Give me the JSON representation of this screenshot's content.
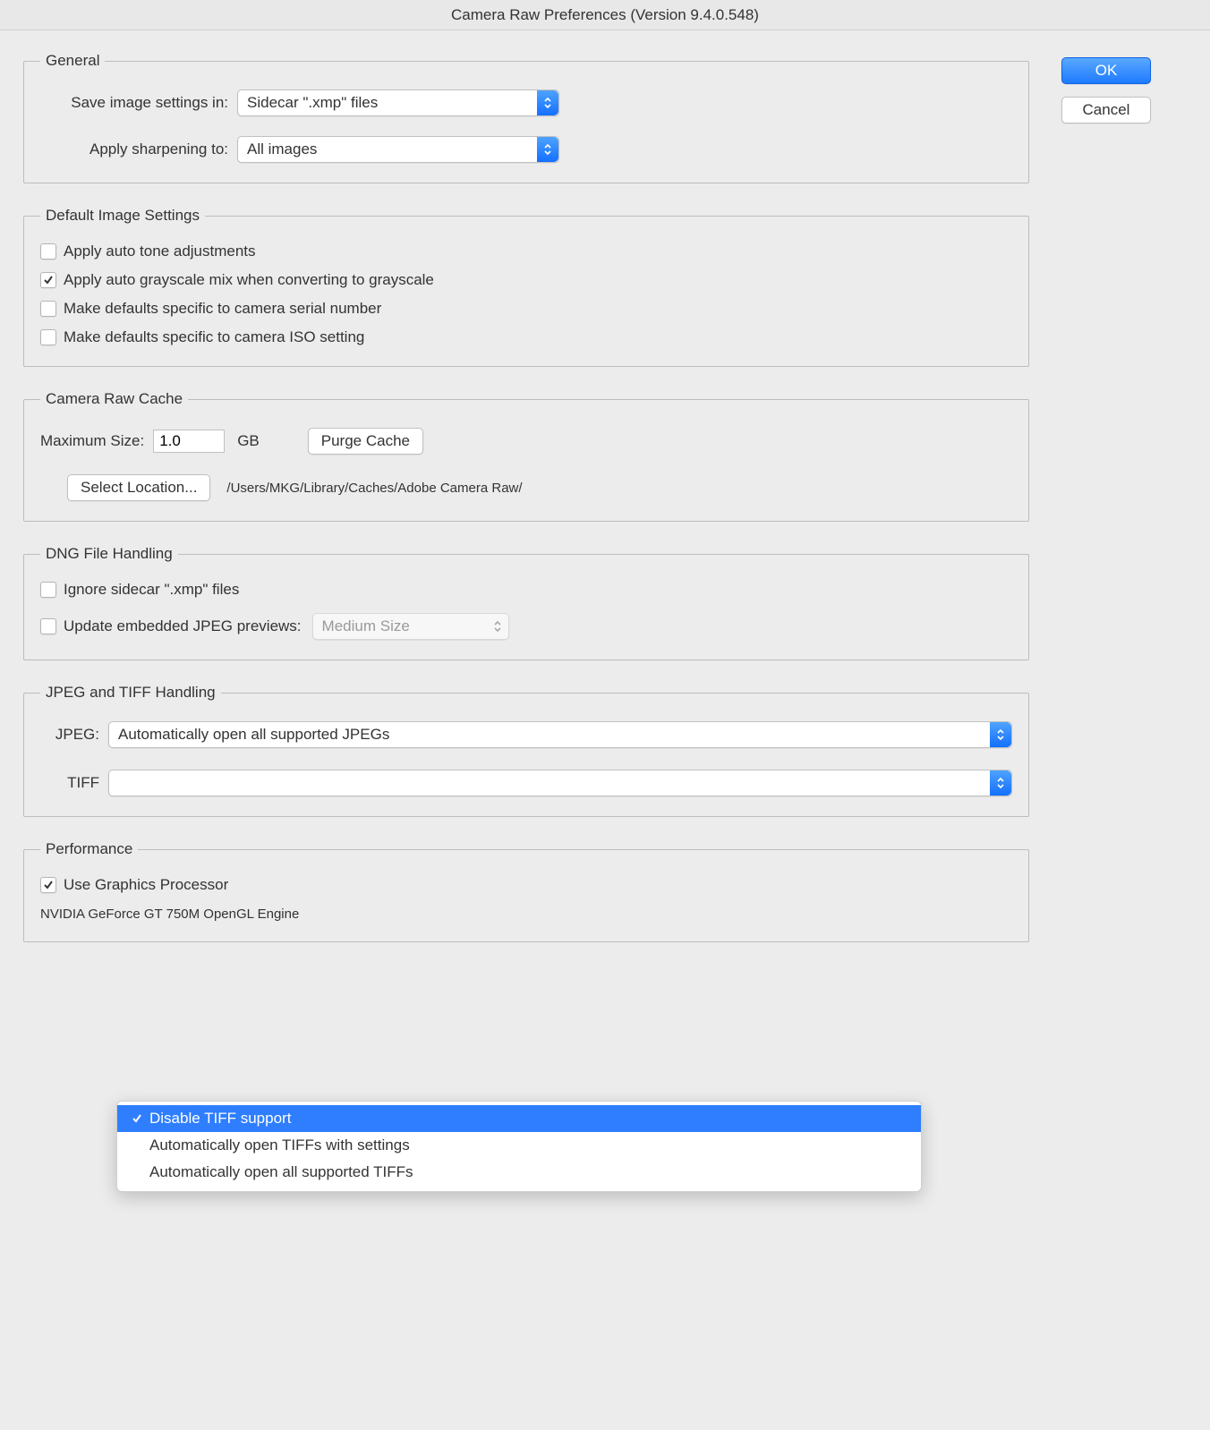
{
  "window_title": "Camera Raw Preferences  (Version 9.4.0.548)",
  "buttons": {
    "ok": "OK",
    "cancel": "Cancel"
  },
  "general": {
    "legend": "General",
    "save_label": "Save image settings in:",
    "save_value": "Sidecar \".xmp\" files",
    "sharpen_label": "Apply sharpening to:",
    "sharpen_value": "All images"
  },
  "default_image": {
    "legend": "Default Image Settings",
    "items": [
      {
        "label": "Apply auto tone adjustments",
        "checked": false
      },
      {
        "label": "Apply auto grayscale mix when converting to grayscale",
        "checked": true
      },
      {
        "label": "Make defaults specific to camera serial number",
        "checked": false
      },
      {
        "label": "Make defaults specific to camera ISO setting",
        "checked": false
      }
    ]
  },
  "cache": {
    "legend": "Camera Raw Cache",
    "max_label": "Maximum Size:",
    "max_value": "1.0",
    "max_unit": "GB",
    "purge_label": "Purge Cache",
    "select_location_label": "Select Location...",
    "path": "/Users/MKG/Library/Caches/Adobe Camera Raw/"
  },
  "dng": {
    "legend": "DNG File Handling",
    "ignore": {
      "label": "Ignore sidecar \".xmp\" files",
      "checked": false
    },
    "update": {
      "label": "Update embedded JPEG previews:",
      "checked": false
    },
    "preview_value": "Medium Size"
  },
  "jpeg_tiff": {
    "legend": "JPEG and TIFF Handling",
    "jpeg_label": "JPEG:",
    "jpeg_value": "Automatically open all supported JPEGs",
    "tiff_label": "TIFF",
    "tiff_options": [
      "Disable TIFF support",
      "Automatically open TIFFs with settings",
      "Automatically open all supported TIFFs"
    ],
    "tiff_selected_index": 0
  },
  "performance": {
    "legend": "Performance",
    "use_gpu": {
      "label": "Use Graphics Processor",
      "checked": true
    },
    "gpu_name": "NVIDIA GeForce GT 750M OpenGL Engine"
  }
}
